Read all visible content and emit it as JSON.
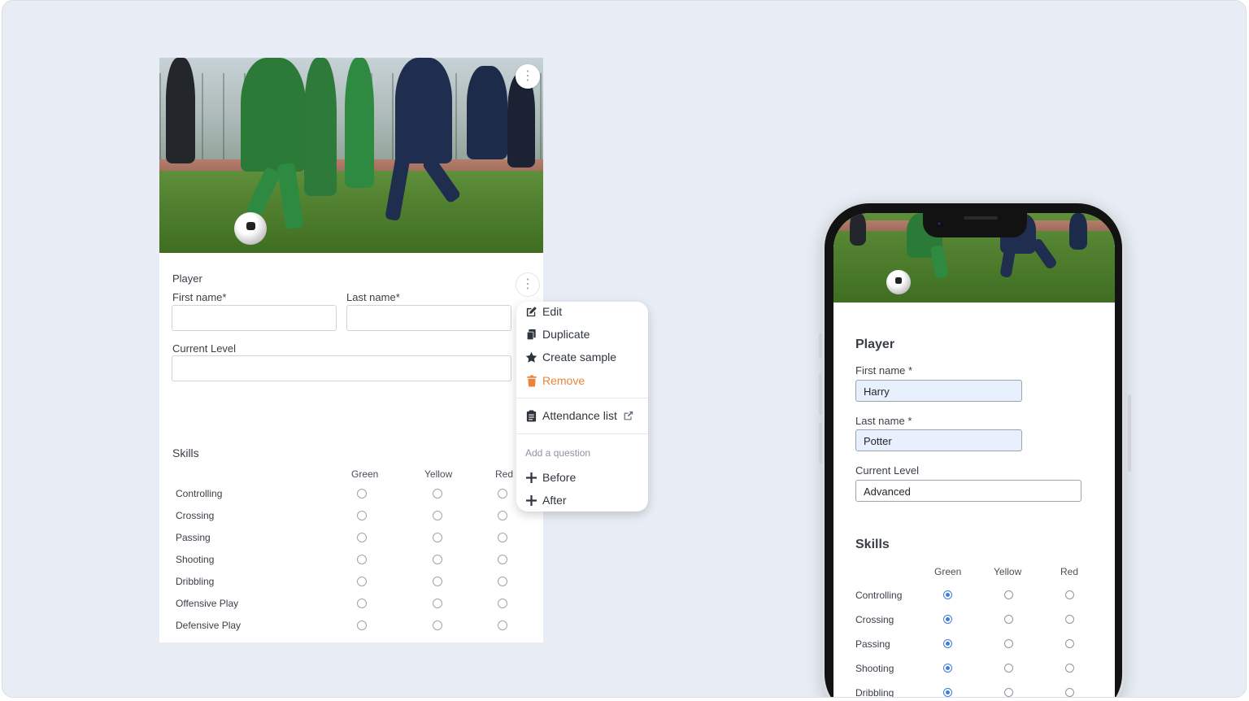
{
  "desktop_form": {
    "section_title": "Player",
    "first_name_label": "First name*",
    "last_name_label": "Last name*",
    "current_level_label": "Current Level",
    "first_name_value": "",
    "last_name_value": "",
    "current_level_value": "",
    "skills_title": "Skills",
    "grade_headers": [
      "Green",
      "Yellow",
      "Red"
    ],
    "skills": [
      "Controlling",
      "Crossing",
      "Passing",
      "Shooting",
      "Dribbling",
      "Offensive Play",
      "Defensive Play"
    ],
    "more_icon": "vertical-dots-icon"
  },
  "context_menu": {
    "items": [
      {
        "label": "Edit",
        "icon": "edit-icon"
      },
      {
        "label": "Duplicate",
        "icon": "copy-icon"
      },
      {
        "label": "Create sample",
        "icon": "star-icon"
      },
      {
        "label": "Remove",
        "icon": "trash-icon",
        "color": "#e8843c"
      }
    ],
    "attendance": {
      "label": "Attendance list",
      "icon": "clipboard-icon",
      "trailing_icon": "external-link-icon"
    },
    "add_question_label": "Add a question",
    "insert_items": [
      {
        "label": "Before",
        "icon": "plus-icon"
      },
      {
        "label": "After",
        "icon": "plus-icon"
      }
    ]
  },
  "mobile_form": {
    "section_title": "Player",
    "first_name_label": "First name *",
    "first_name_value": "Harry",
    "last_name_label": "Last name *",
    "last_name_value": "Potter",
    "current_level_label": "Current Level",
    "current_level_value": "Advanced",
    "skills_title": "Skills",
    "grade_headers": [
      "Green",
      "Yellow",
      "Red"
    ],
    "skills": [
      {
        "name": "Controlling",
        "selected": "Green"
      },
      {
        "name": "Crossing",
        "selected": "Green"
      },
      {
        "name": "Passing",
        "selected": "Green"
      },
      {
        "name": "Shooting",
        "selected": "Green"
      },
      {
        "name": "Dribbling",
        "selected": "Green"
      }
    ]
  },
  "colors": {
    "background": "#e8edf5",
    "accent": "#3b7ddd",
    "danger": "#e8843c",
    "autofill": "#e8f0fe"
  }
}
